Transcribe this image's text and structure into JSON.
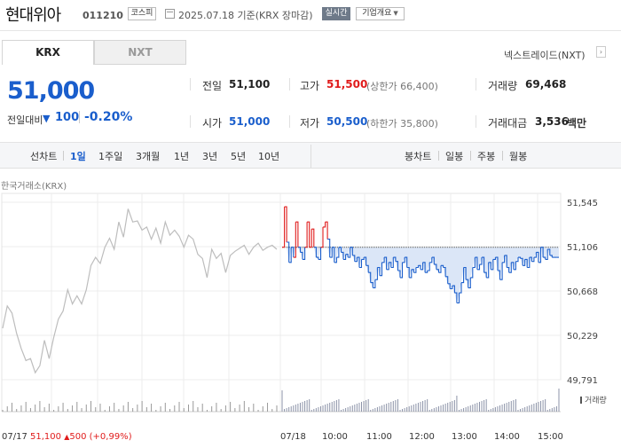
{
  "header": {
    "company_name": "현대위아",
    "stock_code": "011210",
    "market": "코스피",
    "date_info": "2025.07.18  기준(KRX 장마감)",
    "realtime_label": "실시간",
    "overview_label": "기업개요",
    "overview_icon": "caret-down-icon"
  },
  "tabs": [
    {
      "label": "KRX",
      "active": true
    },
    {
      "label": "NXT",
      "active": false
    }
  ],
  "nxt_link": "넥스트레이드(NXT)",
  "price": {
    "current": "51,000",
    "change_label": "전일대비",
    "change_value": "100",
    "change_percent": "-0.20%",
    "direction": "down"
  },
  "quotes": {
    "prev_close": {
      "label": "전일",
      "value": "51,100"
    },
    "high": {
      "label": "고가",
      "value": "51,500",
      "sub": "(상한가 66,400)"
    },
    "volume": {
      "label": "거래량",
      "value": "69,468"
    },
    "open": {
      "label": "시가",
      "value": "51,000"
    },
    "low": {
      "label": "저가",
      "value": "50,500",
      "sub": "(하한가 35,800)"
    },
    "amount": {
      "label": "거래대금",
      "value": "3,536",
      "unit": "백만"
    }
  },
  "toolbar": {
    "line_label": "선차트",
    "periods": [
      "1일",
      "1주일",
      "3개월",
      "1년",
      "3년",
      "5년",
      "10년"
    ],
    "active_period": "1일",
    "candle_label": "봉차트",
    "candles": [
      "일봉",
      "주봉",
      "월봉"
    ]
  },
  "source_label": "한국거래소(KRX)",
  "volume_legend": "거래량",
  "prev_day_info": {
    "date": "07/17",
    "price": "51,100",
    "arrow": "▲",
    "change": "500",
    "pct": "(+0,99%)"
  },
  "colors": {
    "up": "#e01b1b",
    "down": "#1a5ecc",
    "prev_day": "#bdbdbd",
    "baseline_fill": "#dbe6f7"
  },
  "chart_data": {
    "type": "line",
    "y_ticks": [
      "51,545",
      "51,106",
      "50,668",
      "50,229",
      "49,791"
    ],
    "ylim": [
      49791,
      51545
    ],
    "baseline": 51100,
    "x_tick_labels": [
      "07/17",
      "07/18",
      "10:00",
      "11:00",
      "12:00",
      "13:00",
      "14:00",
      "15:00"
    ],
    "prev_day": [
      50300,
      50520,
      50450,
      50250,
      50100,
      49980,
      50000,
      49860,
      49930,
      50180,
      50000,
      50210,
      50390,
      50470,
      50680,
      50540,
      50620,
      50540,
      50680,
      50920,
      51000,
      50940,
      51100,
      51190,
      51080,
      51350,
      51200,
      51480,
      51350,
      51360,
      51270,
      51300,
      51180,
      51290,
      51140,
      51350,
      51220,
      51270,
      51210,
      51100,
      51220,
      51180,
      51030,
      50990,
      50800,
      51080,
      50990,
      51040,
      50850,
      51020,
      51060,
      51090,
      51120,
      51030,
      51100,
      51140,
      51070,
      51100,
      51120,
      51080
    ],
    "today": [
      51100,
      51500,
      51150,
      50950,
      51100,
      51000,
      51350,
      51100,
      51050,
      50980,
      51100,
      51350,
      51100,
      51280,
      51100,
      51000,
      50980,
      51100,
      51300,
      51350,
      51180,
      51000,
      51100,
      50950,
      51000,
      51100,
      51050,
      50980,
      51030,
      51000,
      51100,
      51020,
      50960,
      51000,
      50900,
      50980,
      51000,
      50920,
      50850,
      50750,
      50700,
      50780,
      50900,
      50820,
      50950,
      51000,
      50880,
      50950,
      50900,
      51000,
      50960,
      50870,
      50800,
      50950,
      51000,
      50900,
      50800,
      50880,
      50850,
      50900,
      50920,
      50880,
      50950,
      50850,
      50870,
      50950,
      51000,
      50930,
      50880,
      50850,
      50920,
      50900,
      50810,
      50740,
      50690,
      50720,
      50650,
      50550,
      50650,
      50750,
      50900,
      50780,
      50700,
      50800,
      50900,
      51000,
      50880,
      50930,
      51000,
      50850,
      50800,
      50950,
      50880,
      50980,
      51000,
      50870,
      50780,
      50950,
      51020,
      50900,
      50850,
      50950,
      50880,
      50960,
      51000,
      50990,
      50920,
      50980,
      50900,
      51000,
      50960,
      51000,
      51050,
      50950,
      51100,
      51000,
      50980,
      51080,
      51020,
      51000,
      51000,
      51000,
      51000
    ]
  }
}
